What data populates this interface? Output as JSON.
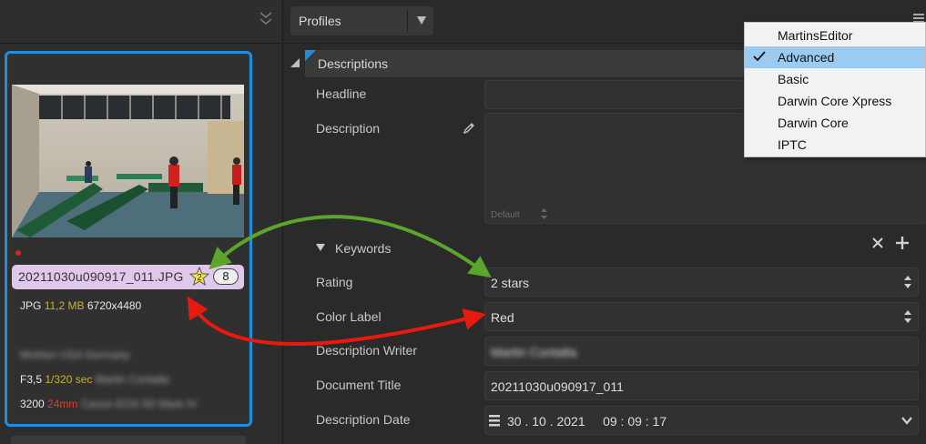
{
  "left": {
    "thumbnail": {
      "filename": "20211030u090917_011.JPG",
      "rating_badge": "2",
      "count_badge": "8",
      "format": "JPG",
      "filesize": "11,2 MB",
      "dimensions": "6720x4480",
      "location_blurred": "Wohlen  USA  Germany",
      "aperture": "F3,5",
      "shutter": "1/320 sec",
      "author_blurred": "Martin Contalla",
      "iso": "3200",
      "focal": "24mm",
      "camera_blurred": "Canon EOS 5D Mark IV",
      "label_color": "#e0c8ea"
    }
  },
  "right": {
    "profiles_select": {
      "label": "Profiles",
      "arrow_icon": "triangle-down-icon"
    },
    "section": {
      "title": "Descriptions"
    },
    "fields": {
      "headline_label": "Headline",
      "description_label": "Description",
      "description_default": "Default",
      "keywords_label": "Keywords",
      "rating_label": "Rating",
      "rating_value": "2 stars",
      "color_label_label": "Color Label",
      "color_label_value": "Red",
      "description_writer_label": "Description Writer",
      "description_writer_value_blurred": "Martin Contalla",
      "document_title_label": "Document Title",
      "document_title_value": "20211030u090917_011",
      "description_date_label": "Description Date",
      "description_date_value": "30 . 10 . 2021     09 : 09 : 17"
    }
  },
  "dropdown": {
    "items": [
      {
        "label": "MartinsEditor",
        "selected": false
      },
      {
        "label": "Advanced",
        "selected": true
      },
      {
        "label": "Basic",
        "selected": false
      },
      {
        "label": "Darwin Core Xpress",
        "selected": false
      },
      {
        "label": "Darwin Core",
        "selected": false
      },
      {
        "label": "IPTC",
        "selected": false
      }
    ]
  },
  "colors": {
    "selection_border": "#1e8fe0",
    "dropdown_selected": "#9ccbf2",
    "green_arrow": "#5aa52a",
    "red_arrow": "#e8190f"
  }
}
